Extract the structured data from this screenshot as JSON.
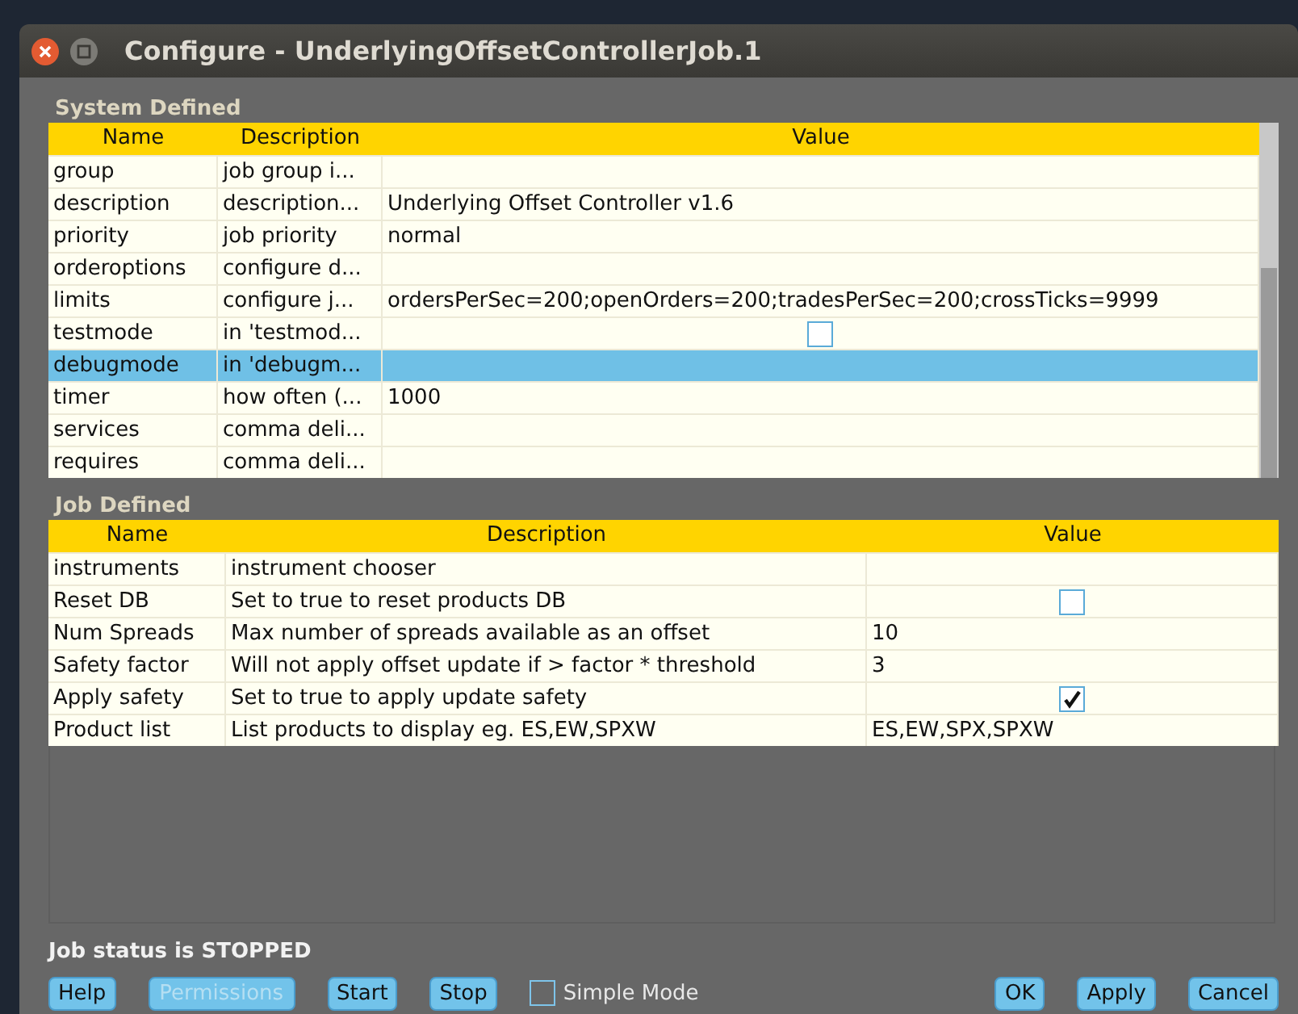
{
  "window": {
    "title": "Configure - UnderlyingOffsetControllerJob.1"
  },
  "system_defined": {
    "title": "System Defined",
    "columns": [
      "Name",
      "Description",
      "Value"
    ],
    "rows": [
      {
        "name": "group",
        "description": "job group i...",
        "kind": "text",
        "value": "",
        "selected": false
      },
      {
        "name": "description",
        "description": "description...",
        "kind": "text",
        "value": "Underlying Offset Controller v1.6",
        "selected": false
      },
      {
        "name": "priority",
        "description": "job priority",
        "kind": "text",
        "value": "normal",
        "selected": false
      },
      {
        "name": "orderoptions",
        "description": "configure d...",
        "kind": "text",
        "value": "",
        "selected": false
      },
      {
        "name": "limits",
        "description": "configure j...",
        "kind": "text",
        "value": "ordersPerSec=200;openOrders=200;tradesPerSec=200;crossTicks=9999",
        "selected": false
      },
      {
        "name": "testmode",
        "description": "in 'testmod...",
        "kind": "checkbox",
        "checked": false,
        "selected": false
      },
      {
        "name": "debugmode",
        "description": "in 'debugm...",
        "kind": "text",
        "value": "",
        "selected": true
      },
      {
        "name": "timer",
        "description": "how often (...",
        "kind": "text",
        "value": "1000",
        "selected": false
      },
      {
        "name": "services",
        "description": "comma deli...",
        "kind": "text",
        "value": "",
        "selected": false
      },
      {
        "name": "requires",
        "description": "comma deli...",
        "kind": "text",
        "value": "",
        "selected": false
      }
    ]
  },
  "job_defined": {
    "title": "Job Defined",
    "columns": [
      "Name",
      "Description",
      "Value"
    ],
    "rows": [
      {
        "name": "instruments",
        "description": "instrument chooser",
        "kind": "text",
        "value": "",
        "selected": false
      },
      {
        "name": "Reset DB",
        "description": "Set to true to reset products DB",
        "kind": "checkbox",
        "checked": false,
        "selected": false
      },
      {
        "name": "Num Spreads",
        "description": "Max number of spreads available as an offset",
        "kind": "text",
        "value": "10",
        "selected": false
      },
      {
        "name": "Safety factor",
        "description": "Will not apply offset update if > factor * threshold",
        "kind": "text",
        "value": "3",
        "selected": false
      },
      {
        "name": "Apply safety",
        "description": "Set to true to apply update safety",
        "kind": "checkbox",
        "checked": true,
        "selected": false
      },
      {
        "name": "Product list",
        "description": "List products to display eg. ES,EW,SPXW",
        "kind": "text",
        "value": "ES,EW,SPX,SPXW",
        "selected": false
      }
    ]
  },
  "status": "Job status is STOPPED",
  "left_buttons": [
    {
      "label": "Help",
      "disabled": false
    },
    {
      "label": "Permissions",
      "disabled": true
    },
    {
      "label": "Start",
      "disabled": false
    },
    {
      "label": "Stop",
      "disabled": false
    }
  ],
  "simple_mode": {
    "label": "Simple Mode",
    "checked": false
  },
  "right_buttons": [
    {
      "label": "OK",
      "disabled": false
    },
    {
      "label": "Apply",
      "disabled": false
    },
    {
      "label": "Cancel",
      "disabled": false
    }
  ]
}
